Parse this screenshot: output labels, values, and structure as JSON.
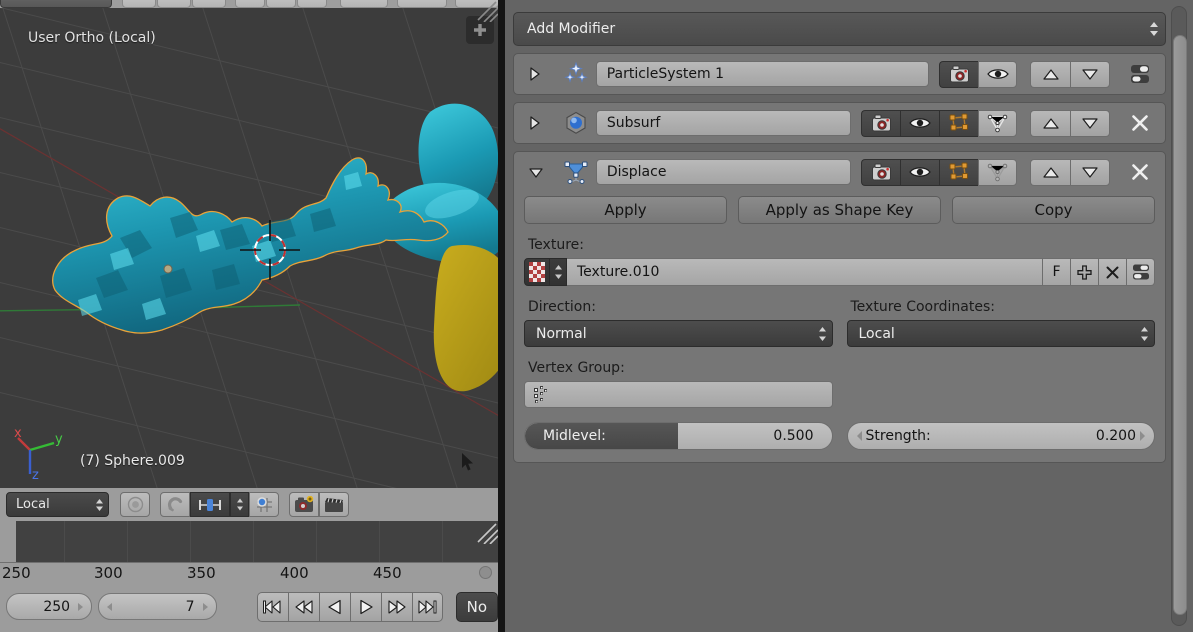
{
  "viewport": {
    "view_label": "User Ortho (Local)",
    "object_label": "(7) Sphere.009",
    "axis_x": "x",
    "axis_y": "y",
    "axis_z": "z",
    "npanel_icon": "plus-icon",
    "cursor_icon": "mouse-cursor-icon",
    "footer": {
      "transform_orientation": "Local",
      "proportional_edit_icon": "circle-falloff-icon",
      "snap_magnet_icon": "magnet-icon",
      "snap_target_icon": "snap-vertex-icon",
      "snap_dropdown_icon": "chevron-updown-icon",
      "snap_mode_icon": "snap-grid-icon",
      "render_icon": "camera-add-icon",
      "animation_icon": "clapperboard-icon"
    }
  },
  "timeline": {
    "ruler_ticks": [
      "250",
      "300",
      "350",
      "400",
      "450"
    ],
    "end_frame": "250",
    "current_frame": "7",
    "playback_buttons": [
      {
        "name": "jump-to-start-button",
        "glyph": "rewind-start-icon"
      },
      {
        "name": "previous-keyframe-button",
        "glyph": "rewind-icon"
      },
      {
        "name": "play-reverse-button",
        "glyph": "play-reverse-icon"
      },
      {
        "name": "play-button",
        "glyph": "play-icon"
      },
      {
        "name": "next-keyframe-button",
        "glyph": "fast-forward-icon"
      },
      {
        "name": "jump-to-end-button",
        "glyph": "fast-forward-end-icon"
      }
    ],
    "sync_mode": "No"
  },
  "properties": {
    "add_modifier_label": "Add Modifier",
    "add_modifier_icon": "chevron-updown-icon",
    "modifiers": [
      {
        "name": "ParticleSystem 1",
        "icon": "particles-icon",
        "expanded": false,
        "expander_icon": "triangle-right-icon",
        "toggles": [
          {
            "name": "render-toggle",
            "icon": "camera-icon",
            "on": true
          },
          {
            "name": "realtime-toggle",
            "icon": "eye-icon",
            "on": false
          }
        ],
        "has_edit_mode": false,
        "has_cage": false,
        "move_up_icon": "triangle-up-icon",
        "move_down_icon": "triangle-down-icon",
        "end_icon": "panel-pin-icon",
        "has_close": false
      },
      {
        "name": "Subsurf",
        "icon": "subsurf-sphere-icon",
        "expanded": false,
        "expander_icon": "triangle-right-icon",
        "toggles": [
          {
            "name": "render-toggle",
            "icon": "camera-icon",
            "on": true
          },
          {
            "name": "realtime-toggle",
            "icon": "eye-icon",
            "on": true
          },
          {
            "name": "edit-mode-toggle",
            "icon": "edit-mode-icon",
            "on": true
          },
          {
            "name": "on-cage-toggle",
            "icon": "cage-icon",
            "on": false
          }
        ],
        "move_up_icon": "triangle-up-icon",
        "move_down_icon": "triangle-down-icon",
        "end_icon": "close-x-icon",
        "has_close": true
      },
      {
        "name": "Displace",
        "icon": "displace-icon",
        "expanded": true,
        "expander_icon": "triangle-down-icon",
        "toggles": [
          {
            "name": "render-toggle",
            "icon": "camera-icon",
            "on": true
          },
          {
            "name": "realtime-toggle",
            "icon": "eye-icon",
            "on": true
          },
          {
            "name": "edit-mode-toggle",
            "icon": "edit-mode-icon",
            "on": true
          },
          {
            "name": "on-cage-toggle",
            "icon": "cage-icon",
            "on": false
          }
        ],
        "move_up_icon": "triangle-up-icon",
        "move_down_icon": "triangle-down-icon",
        "end_icon": "close-x-icon",
        "has_close": true
      }
    ],
    "displace": {
      "apply_label": "Apply",
      "apply_shape_key_label": "Apply as Shape Key",
      "copy_label": "Copy",
      "texture_section_label": "Texture:",
      "texture_name": "Texture.010",
      "texture_swatch_icon": "checker-texture-icon",
      "texture_spin_icon": "chevron-updown-icon",
      "texture_fake_user_label": "F",
      "texture_new_icon": "plus-icon",
      "texture_unlink_icon": "close-x-icon",
      "texture_browse_icon": "panel-pin-icon",
      "direction_label": "Direction:",
      "direction_value": "Normal",
      "direction_icon": "chevron-updown-icon",
      "texture_coords_label": "Texture Coordinates:",
      "texture_coords_value": "Local",
      "texture_coords_icon": "chevron-updown-icon",
      "vertex_group_label": "Vertex Group:",
      "vertex_group_value": "",
      "vertex_group_icon": "vertex-group-icon",
      "midlevel_label": "Midlevel:",
      "midlevel_value": "0.500",
      "midlevel_fill_pct": 50,
      "strength_label": "Strength:",
      "strength_value": "0.200",
      "strength_left_icon": "triangle-left-icon",
      "strength_right_icon": "triangle-right-icon"
    }
  },
  "scrollbar": {
    "name": "properties-vertical-scrollbar"
  }
}
